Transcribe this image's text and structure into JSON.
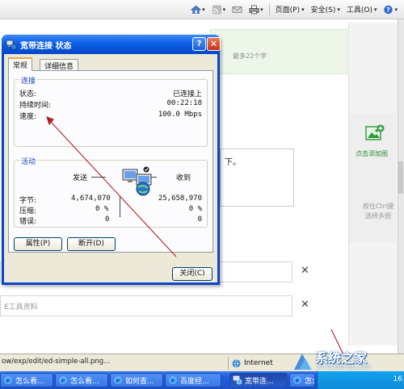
{
  "toolbar": {
    "items": [
      {
        "label": "",
        "icon": "home-icon"
      },
      {
        "label": "",
        "icon": "feeds-icon"
      },
      {
        "label": "",
        "icon": "mail-icon"
      },
      {
        "label": "",
        "icon": "print-icon"
      },
      {
        "label": "页面(P)",
        "icon": ""
      },
      {
        "label": "安全(S)",
        "icon": ""
      },
      {
        "label": "工具(O)",
        "icon": ""
      },
      {
        "label": "",
        "icon": "help-icon"
      }
    ]
  },
  "page": {
    "top_hint": "最多22个字",
    "add_image_label": "点击添加图",
    "ctrl_hint": "按住Ctrl键选择多图",
    "editor_fragment": "下。",
    "row2_placeholder": "E工具资料"
  },
  "dialog": {
    "title": "宽带连接 状态",
    "help_label": "?",
    "close_glyph": "✕",
    "tabs": [
      "常规",
      "详细信息"
    ],
    "connection": {
      "title": "连接",
      "rows": [
        {
          "label": "状态:",
          "value": "已连接上"
        },
        {
          "label": "持续时间:",
          "value": "00:22:18"
        },
        {
          "label": "速度:",
          "value": "100.0 Mbps"
        }
      ]
    },
    "activity": {
      "title": "活动",
      "sent_label": "发送",
      "received_label": "收到",
      "rows": [
        {
          "label": "字节:",
          "sent": "4,674,070",
          "received": "25,658,970"
        },
        {
          "label": "压缩:",
          "sent": "0 %",
          "received": "0 %"
        },
        {
          "label": "错误:",
          "sent": "0",
          "received": "0"
        }
      ]
    },
    "properties_button": "属性(P)",
    "disconnect_button": "断开(D)",
    "close_button": "关闭(C)"
  },
  "statusbar": {
    "url": "ow/exp/edit/ed-simple-all.png...",
    "zone": "Internet"
  },
  "taskbar": {
    "buttons": [
      "怎么看...",
      "怎么看...",
      "如何查...",
      "百度经...",
      "宽带连...",
      "怎么看..."
    ],
    "active_index": 4,
    "clock": "16"
  },
  "watermark": {
    "text": "系统之家",
    "sub": "XITONGZHIJIA.NET"
  },
  "colors": {
    "title_blue": "#0b5ee6",
    "group_title": "#1640b0",
    "annotation_arrow": "#b02020",
    "taskbar": "#245edb"
  }
}
